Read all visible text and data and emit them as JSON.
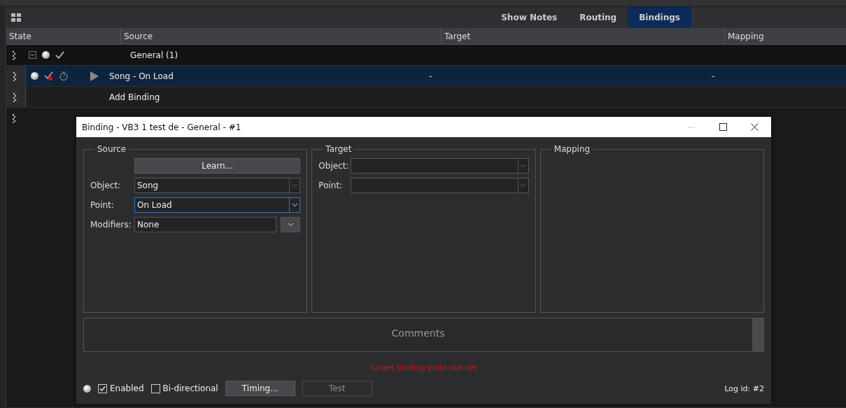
{
  "tabs": [
    {
      "label": "Show Notes",
      "selected": false
    },
    {
      "label": "Routing",
      "selected": false
    },
    {
      "label": "Bindings",
      "selected": true
    }
  ],
  "table": {
    "columns": [
      "State",
      "Source",
      "Target",
      "Mapping"
    ],
    "rows": [
      {
        "kind": "group",
        "expanded": true,
        "enabled": true,
        "source": "General (1)"
      },
      {
        "kind": "binding",
        "selected": true,
        "enabled": true,
        "error": true,
        "source": "Song - On Load",
        "target": "-",
        "mapping": "-"
      },
      {
        "kind": "add",
        "source": "Add Binding"
      },
      {
        "kind": "blank"
      }
    ]
  },
  "dialog": {
    "title": "Binding - VB3 1 test de - General - #1",
    "source": {
      "title": "Source",
      "learn": "Learn...",
      "object_label": "Object:",
      "object": "Song",
      "point_label": "Point:",
      "point": "On Load",
      "modifiers_label": "Modifiers:",
      "modifiers": "None"
    },
    "target": {
      "title": "Target",
      "object_label": "Object:",
      "point_label": "Point:"
    },
    "mapping": {
      "title": "Mapping"
    },
    "comments": {
      "placeholder": "Comments"
    },
    "error": "target binding point not set",
    "enabled": {
      "label": "Enabled",
      "checked": true
    },
    "bidirectional": {
      "label": "Bi-directional",
      "checked": false
    },
    "timing": "Timing...",
    "test": {
      "label": "Test",
      "disabled": true
    },
    "log_id": "Log id: #2"
  }
}
